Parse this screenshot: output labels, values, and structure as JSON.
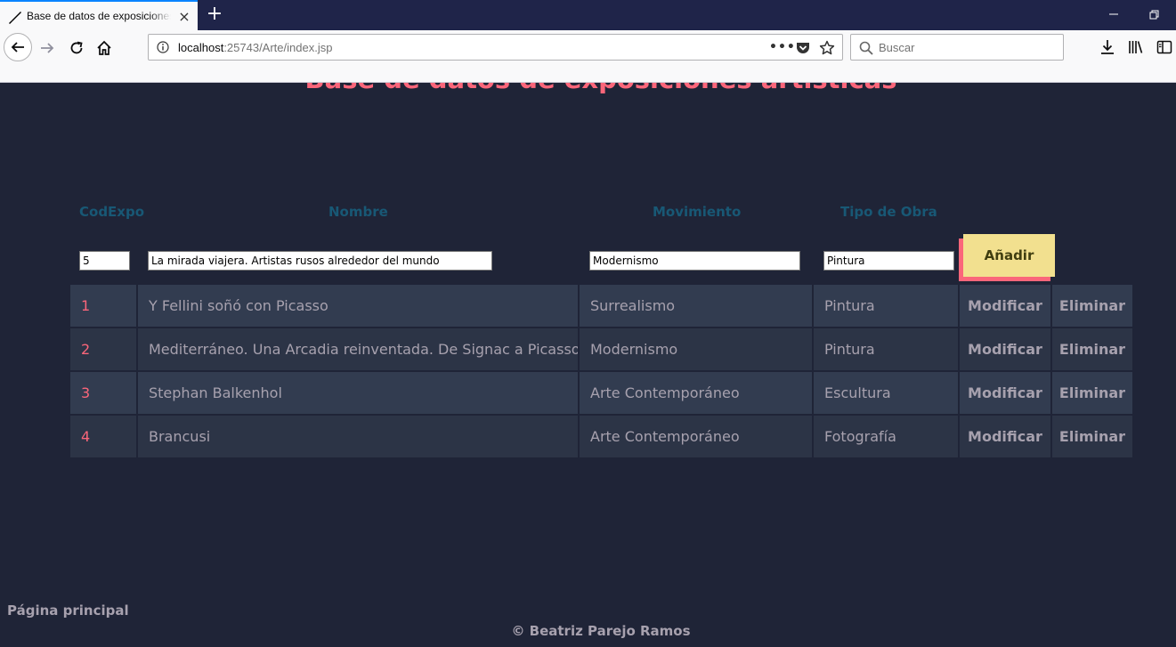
{
  "browser": {
    "tab_title": "Base de datos de exposiciones artísticas",
    "url_host": "localhost",
    "url_rest": ":25743/Arte/index.jsp",
    "search_placeholder": "Buscar",
    "accent_color": "#0a84ff"
  },
  "page": {
    "title": "Base de datos de exposiciones artísticas",
    "colors": {
      "background": "#1f2437",
      "title": "#fb667a",
      "header": "#185875",
      "text": "#a7a1ae",
      "button": "#f2e08f"
    }
  },
  "form": {
    "headers": {
      "codexpo": "CodExpo",
      "nombre": "Nombre",
      "movimiento": "Movimiento",
      "tipo": "Tipo de Obra"
    },
    "values": {
      "codexpo": "5",
      "nombre": "La mirada viajera. Artistas rusos alrededor del mundo",
      "movimiento": "Modernismo",
      "tipo": "Pintura"
    },
    "add_label": "Añadir"
  },
  "rows": [
    {
      "cod": "1",
      "nombre": "Y Fellini soñó con Picasso",
      "movimiento": "Surrealismo",
      "tipo": "Pintura",
      "modify": "Modificar",
      "delete": "Eliminar"
    },
    {
      "cod": "2",
      "nombre": "Mediterráneo. Una Arcadia reinventada. De Signac a Picasso",
      "movimiento": "Modernismo",
      "tipo": "Pintura",
      "modify": "Modificar",
      "delete": "Eliminar"
    },
    {
      "cod": "3",
      "nombre": "Stephan Balkenhol",
      "movimiento": "Arte Contemporáneo",
      "tipo": "Escultura",
      "modify": "Modificar",
      "delete": "Eliminar"
    },
    {
      "cod": "4",
      "nombre": "Brancusi",
      "movimiento": "Arte Contemporáneo",
      "tipo": "Fotografía",
      "modify": "Modificar",
      "delete": "Eliminar"
    }
  ],
  "nav": {
    "home_link": "Página principal"
  },
  "footer": {
    "copyright": "© Beatriz Parejo Ramos"
  }
}
